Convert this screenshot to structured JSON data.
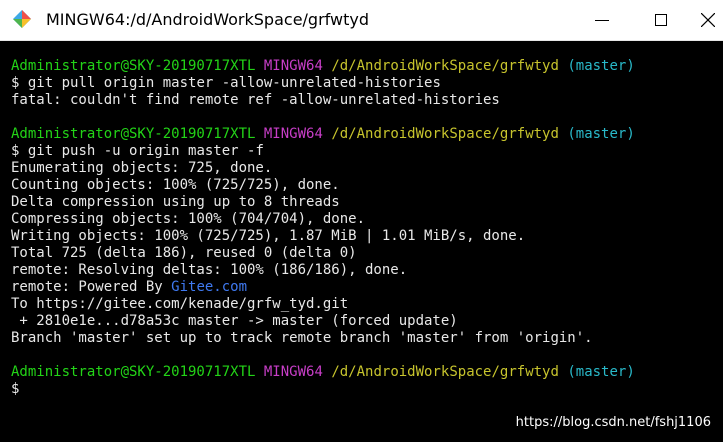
{
  "window": {
    "title": "MINGW64:/d/AndroidWorkSpace/grfwtyd",
    "controls": {
      "minimize": "minimize",
      "maximize": "maximize",
      "close": "close"
    }
  },
  "colors": {
    "user_host": "#23d417",
    "shell": "#c73ec7",
    "path": "#c7c42d",
    "branch": "#29b9c9",
    "link": "#3f79f0",
    "text": "#e8e8e8",
    "background": "#000000"
  },
  "prompt": {
    "user_host": "Administrator@SKY-20190717XTL",
    "shell": "MINGW64",
    "path": "/d/AndroidWorkSpace/grfwtyd",
    "branch": "(master)",
    "symbol": "$"
  },
  "session1": {
    "command": "git pull origin master -allow-unrelated-histories",
    "output": [
      "fatal: couldn't find remote ref -allow-unrelated-histories"
    ]
  },
  "session2": {
    "command": "git push -u origin master -f",
    "output": [
      "Enumerating objects: 725, done.",
      "Counting objects: 100% (725/725), done.",
      "Delta compression using up to 8 threads",
      "Compressing objects: 100% (704/704), done.",
      "Writing objects: 100% (725/725), 1.87 MiB | 1.01 MiB/s, done.",
      "Total 725 (delta 186), reused 0 (delta 0)",
      "remote: Resolving deltas: 100% (186/186), done."
    ],
    "powered_prefix": "remote: Powered By ",
    "powered_link": "Gitee.com",
    "output_after": [
      "To https://gitee.com/kenade/grfw_tyd.git",
      " + 2810e1e...d78a53c master -> master (forced update)",
      "Branch 'master' set up to track remote branch 'master' from 'origin'."
    ]
  },
  "watermark": "https://blog.csdn.net/fshj1106"
}
